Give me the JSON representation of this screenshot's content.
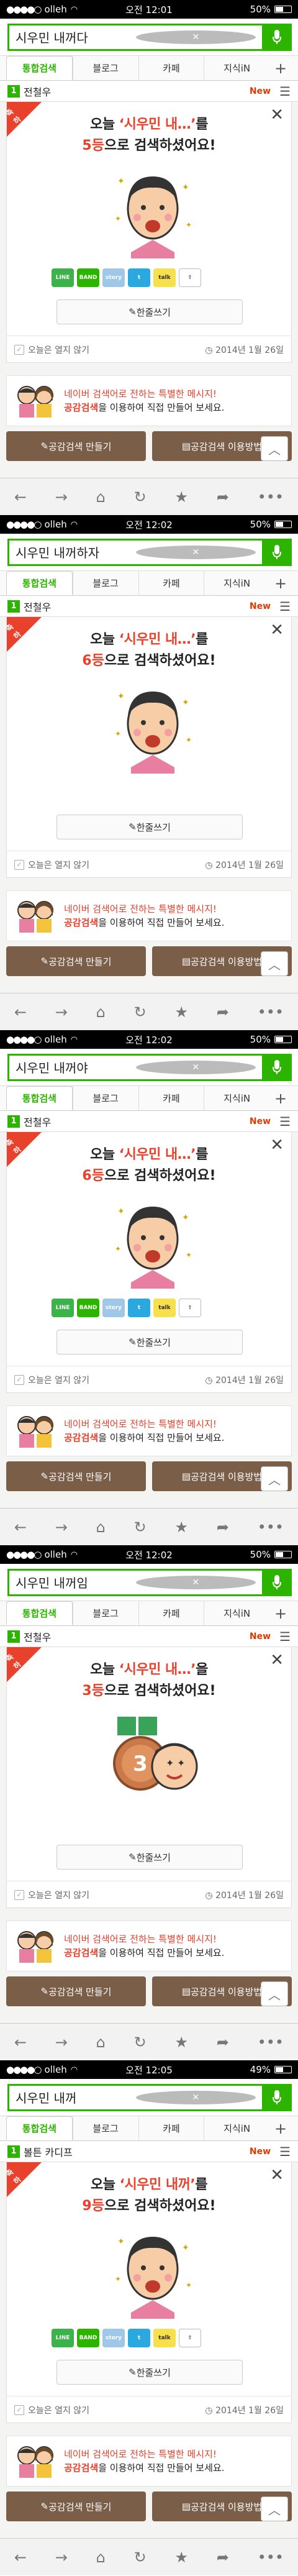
{
  "frames": [
    {
      "status": {
        "carrier": "olleh",
        "time": "오전 12:01",
        "battery": "50%",
        "battery_level": 0.5
      },
      "query": "시우민 내꺼다",
      "tabs": [
        "통합검색",
        "블로그",
        "카페",
        "지식iN"
      ],
      "rank_item": {
        "num": "1",
        "name": "전철우",
        "badge": "New"
      },
      "ribbon": "축하",
      "line1_pre": "오늘 ",
      "quote": "‘시우민 내…’",
      "line1_post": "를",
      "rank_num": "5등",
      "line2_post": "으로 검색하셨어요!",
      "share_icons": true,
      "write_label": "한줄쓰기",
      "hide_today": "오늘은 열지 않기",
      "date": "2014년 1월 26일",
      "promo_line1": "네이버 검색어로 전하는 특별한 메시지!",
      "promo_em": "공감검색",
      "promo_line2": "을 이용하여 직접 만들어 보세요.",
      "btn_make": "공감검색 만들기",
      "btn_use": "공감검색 이용방법"
    },
    {
      "status": {
        "carrier": "olleh",
        "time": "오전 12:02",
        "battery": "50%",
        "battery_level": 0.5
      },
      "query": "시우민 내꺼하자",
      "tabs": [
        "통합검색",
        "블로그",
        "카페",
        "지식iN"
      ],
      "rank_item": {
        "num": "1",
        "name": "전철우",
        "badge": "New"
      },
      "ribbon": "축하",
      "line1_pre": "오늘 ",
      "quote": "‘시우민 내…’",
      "line1_post": "를",
      "rank_num": "6등",
      "line2_post": "으로 검색하셨어요!",
      "share_icons": false,
      "write_label": "한줄쓰기",
      "hide_today": "오늘은 열지 않기",
      "date": "2014년 1월 26일",
      "promo_line1": "네이버 검색어로 전하는 특별한 메시지!",
      "promo_em": "공감검색",
      "promo_line2": "을 이용하여 직접 만들어 보세요.",
      "btn_make": "공감검색 만들기",
      "btn_use": "공감검색 이용방법"
    },
    {
      "status": {
        "carrier": "olleh",
        "time": "오전 12:02",
        "battery": "50%",
        "battery_level": 0.5
      },
      "query": "시우민 내꺼야",
      "tabs": [
        "통합검색",
        "블로그",
        "카페",
        "지식iN"
      ],
      "rank_item": {
        "num": "1",
        "name": "전철우",
        "badge": "New"
      },
      "ribbon": "축하",
      "line1_pre": "오늘 ",
      "quote": "‘시우민 내…’",
      "line1_post": "를",
      "rank_num": "6등",
      "line2_post": "으로 검색하셨어요!",
      "share_icons": true,
      "write_label": "한줄쓰기",
      "hide_today": "오늘은 열지 않기",
      "date": "2014년 1월 26일",
      "promo_line1": "네이버 검색어로 전하는 특별한 메시지!",
      "promo_em": "공감검색",
      "promo_line2": "을 이용하여 직접 만들어 보세요.",
      "btn_make": "공감검색 만들기",
      "btn_use": "공감검색 이용방법"
    },
    {
      "status": {
        "carrier": "olleh",
        "time": "오전 12:02",
        "battery": "50%",
        "battery_level": 0.5
      },
      "query": "시우민 내꺼임",
      "tabs": [
        "통합검색",
        "블로그",
        "카페",
        "지식iN"
      ],
      "rank_item": {
        "num": "1",
        "name": "전철우",
        "badge": "New"
      },
      "ribbon": "축하",
      "line1_pre": "오늘 ",
      "quote": "‘시우민 내…’",
      "line1_post": "을",
      "rank_num": "3등",
      "line2_post": "으로 검색하셨어요!",
      "share_icons": false,
      "write_label": "한줄쓰기",
      "hide_today": "오늘은 열지 않기",
      "date": "2014년 1월 26일",
      "promo_line1": "네이버 검색어로 전하는 특별한 메시지!",
      "promo_em": "공감검색",
      "promo_line2": "을 이용하여 직접 만들어 보세요.",
      "btn_make": "공감검색 만들기",
      "btn_use": "공감검색 이용방법",
      "medal": "3"
    },
    {
      "status": {
        "carrier": "olleh",
        "time": "오전 12:05",
        "battery": "49%",
        "battery_level": 0.49
      },
      "query": "시우민 내꺼",
      "tabs": [
        "통합검색",
        "블로그",
        "카페",
        "지식iN"
      ],
      "rank_item": {
        "num": "1",
        "name": "볼튼 카디프",
        "badge": "New"
      },
      "ribbon": "축하",
      "line1_pre": "오늘 ",
      "quote": "‘시우민 내꺼’",
      "line1_post": "를",
      "rank_num": "9등",
      "line2_post": "으로 검색하셨어요!",
      "share_icons": true,
      "write_label": "한줄쓰기",
      "hide_today": "오늘은 열지 않기",
      "date": "2014년 1월 26일",
      "promo_line1": "네이버 검색어로 전하는 특별한 메시지!",
      "promo_em": "공감검색",
      "promo_line2": "을 이용하여 직접 만들어 보세요.",
      "btn_make": "공감검색 만들기",
      "btn_use": "공감검색 이용방법"
    }
  ],
  "share_labels": {
    "line": "LINE",
    "band": "BAND",
    "kakaostory": "story",
    "twitter": "t",
    "kakaotalk": "talk"
  },
  "colors": {
    "naver_green": "#2db400",
    "accent_red": "#e8412c",
    "brown_button": "#7a5e47"
  },
  "toolbar_icons": [
    "back-arrow-icon",
    "forward-arrow-icon",
    "home-icon",
    "refresh-icon",
    "bookmark-star-icon",
    "share-icon",
    "more-icon"
  ]
}
